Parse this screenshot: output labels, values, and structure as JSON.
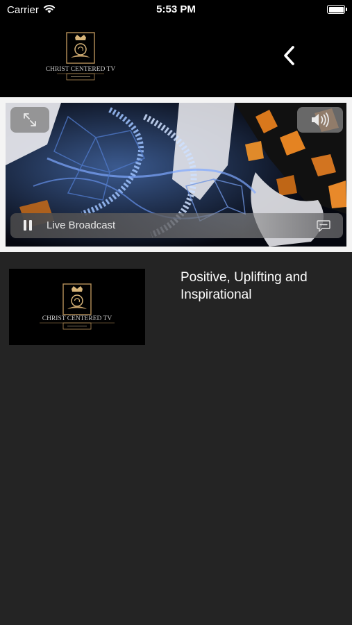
{
  "status_bar": {
    "carrier": "Carrier",
    "time": "5:53 PM"
  },
  "header": {
    "logo_text": "CHRIST CENTERED TV"
  },
  "player": {
    "status_label": "Live Broadcast"
  },
  "episode": {
    "thumbnail_logo_text": "CHRIST CENTERED TV",
    "description": "Positive, Uplifting and Inspirational"
  },
  "colors": {
    "background": "#242424",
    "header": "#000000",
    "gold": "#b8925a"
  }
}
